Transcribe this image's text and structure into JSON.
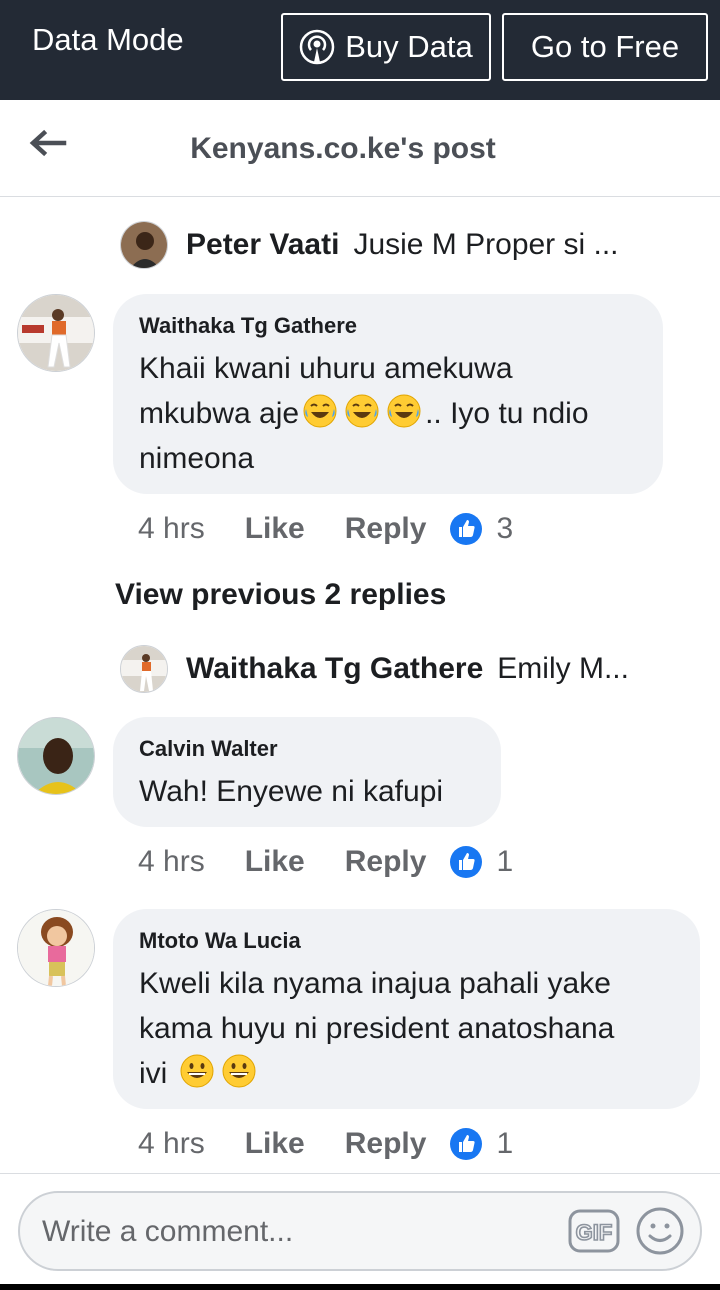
{
  "status_bar": {
    "data_mode_label": "Data Mode",
    "buy_data_label": "Buy Data",
    "go_to_free_label": "Go to Free"
  },
  "header": {
    "title": "Kenyans.co.ke's post"
  },
  "reply_previews": [
    {
      "name": "Peter Vaati",
      "text": "Jusie M Proper si ..."
    },
    {
      "name": "Waithaka Tg Gathere",
      "text": "Emily M..."
    }
  ],
  "comments": [
    {
      "author": "Waithaka Tg Gathere",
      "text_lines": [
        "Khaii kwani uhuru amekuwa",
        "mkubwa aje",
        ".. Iyo tu ndio",
        "nimeona"
      ],
      "emojis": [
        "laughing-tears-emoji",
        "laughing-tears-emoji",
        "laughing-tears-emoji"
      ],
      "time": "4 hrs",
      "like_label": "Like",
      "reply_label": "Reply",
      "like_count": "3"
    },
    {
      "author": "Calvin Walter",
      "text": "Wah! Enyewe ni kafupi",
      "time": "4 hrs",
      "like_label": "Like",
      "reply_label": "Reply",
      "like_count": "1"
    },
    {
      "author": "Mtoto Wa Lucia",
      "text_lines": [
        "Kweli kila nyama inajua pahali yake",
        "kama huyu ni president anatoshana",
        "ivi"
      ],
      "emojis": [
        "grinning-emoji",
        "grinning-emoji"
      ],
      "time": "4 hrs",
      "like_label": "Like",
      "reply_label": "Reply",
      "like_count": "1"
    }
  ],
  "view_previous": "View previous 2 replies",
  "composer": {
    "placeholder": "Write a comment..."
  },
  "colors": {
    "topbar_bg": "#232a35",
    "bubble_bg": "#f0f2f5",
    "like_blue": "#1877f2"
  }
}
